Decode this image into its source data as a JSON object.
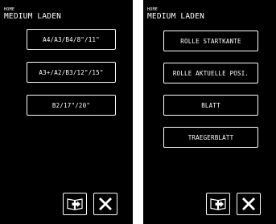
{
  "screens": [
    {
      "home_label": "HOME",
      "title": "MEDIUM LADEN",
      "options": [
        {
          "label": "A4/A3/B4/8\"/11\""
        },
        {
          "label": "A3+/A2/B3/12\"/15\""
        },
        {
          "label": "B2/17\"/20\""
        }
      ],
      "icons": {
        "manual": "manual-book-icon",
        "close": "close-icon"
      }
    },
    {
      "home_label": "HOME",
      "title": "MEDIUM LADEN",
      "options": [
        {
          "label": "ROLLE STARTKANTE"
        },
        {
          "label": "ROLLE AKTUELLE POSI."
        },
        {
          "label": "BLATT"
        },
        {
          "label": "TRAEGERBLATT"
        }
      ],
      "icons": {
        "manual": "manual-book-icon",
        "close": "close-icon"
      }
    }
  ],
  "colors": {
    "background": "#000000",
    "foreground": "#ffffff",
    "page": "#ffffff"
  }
}
